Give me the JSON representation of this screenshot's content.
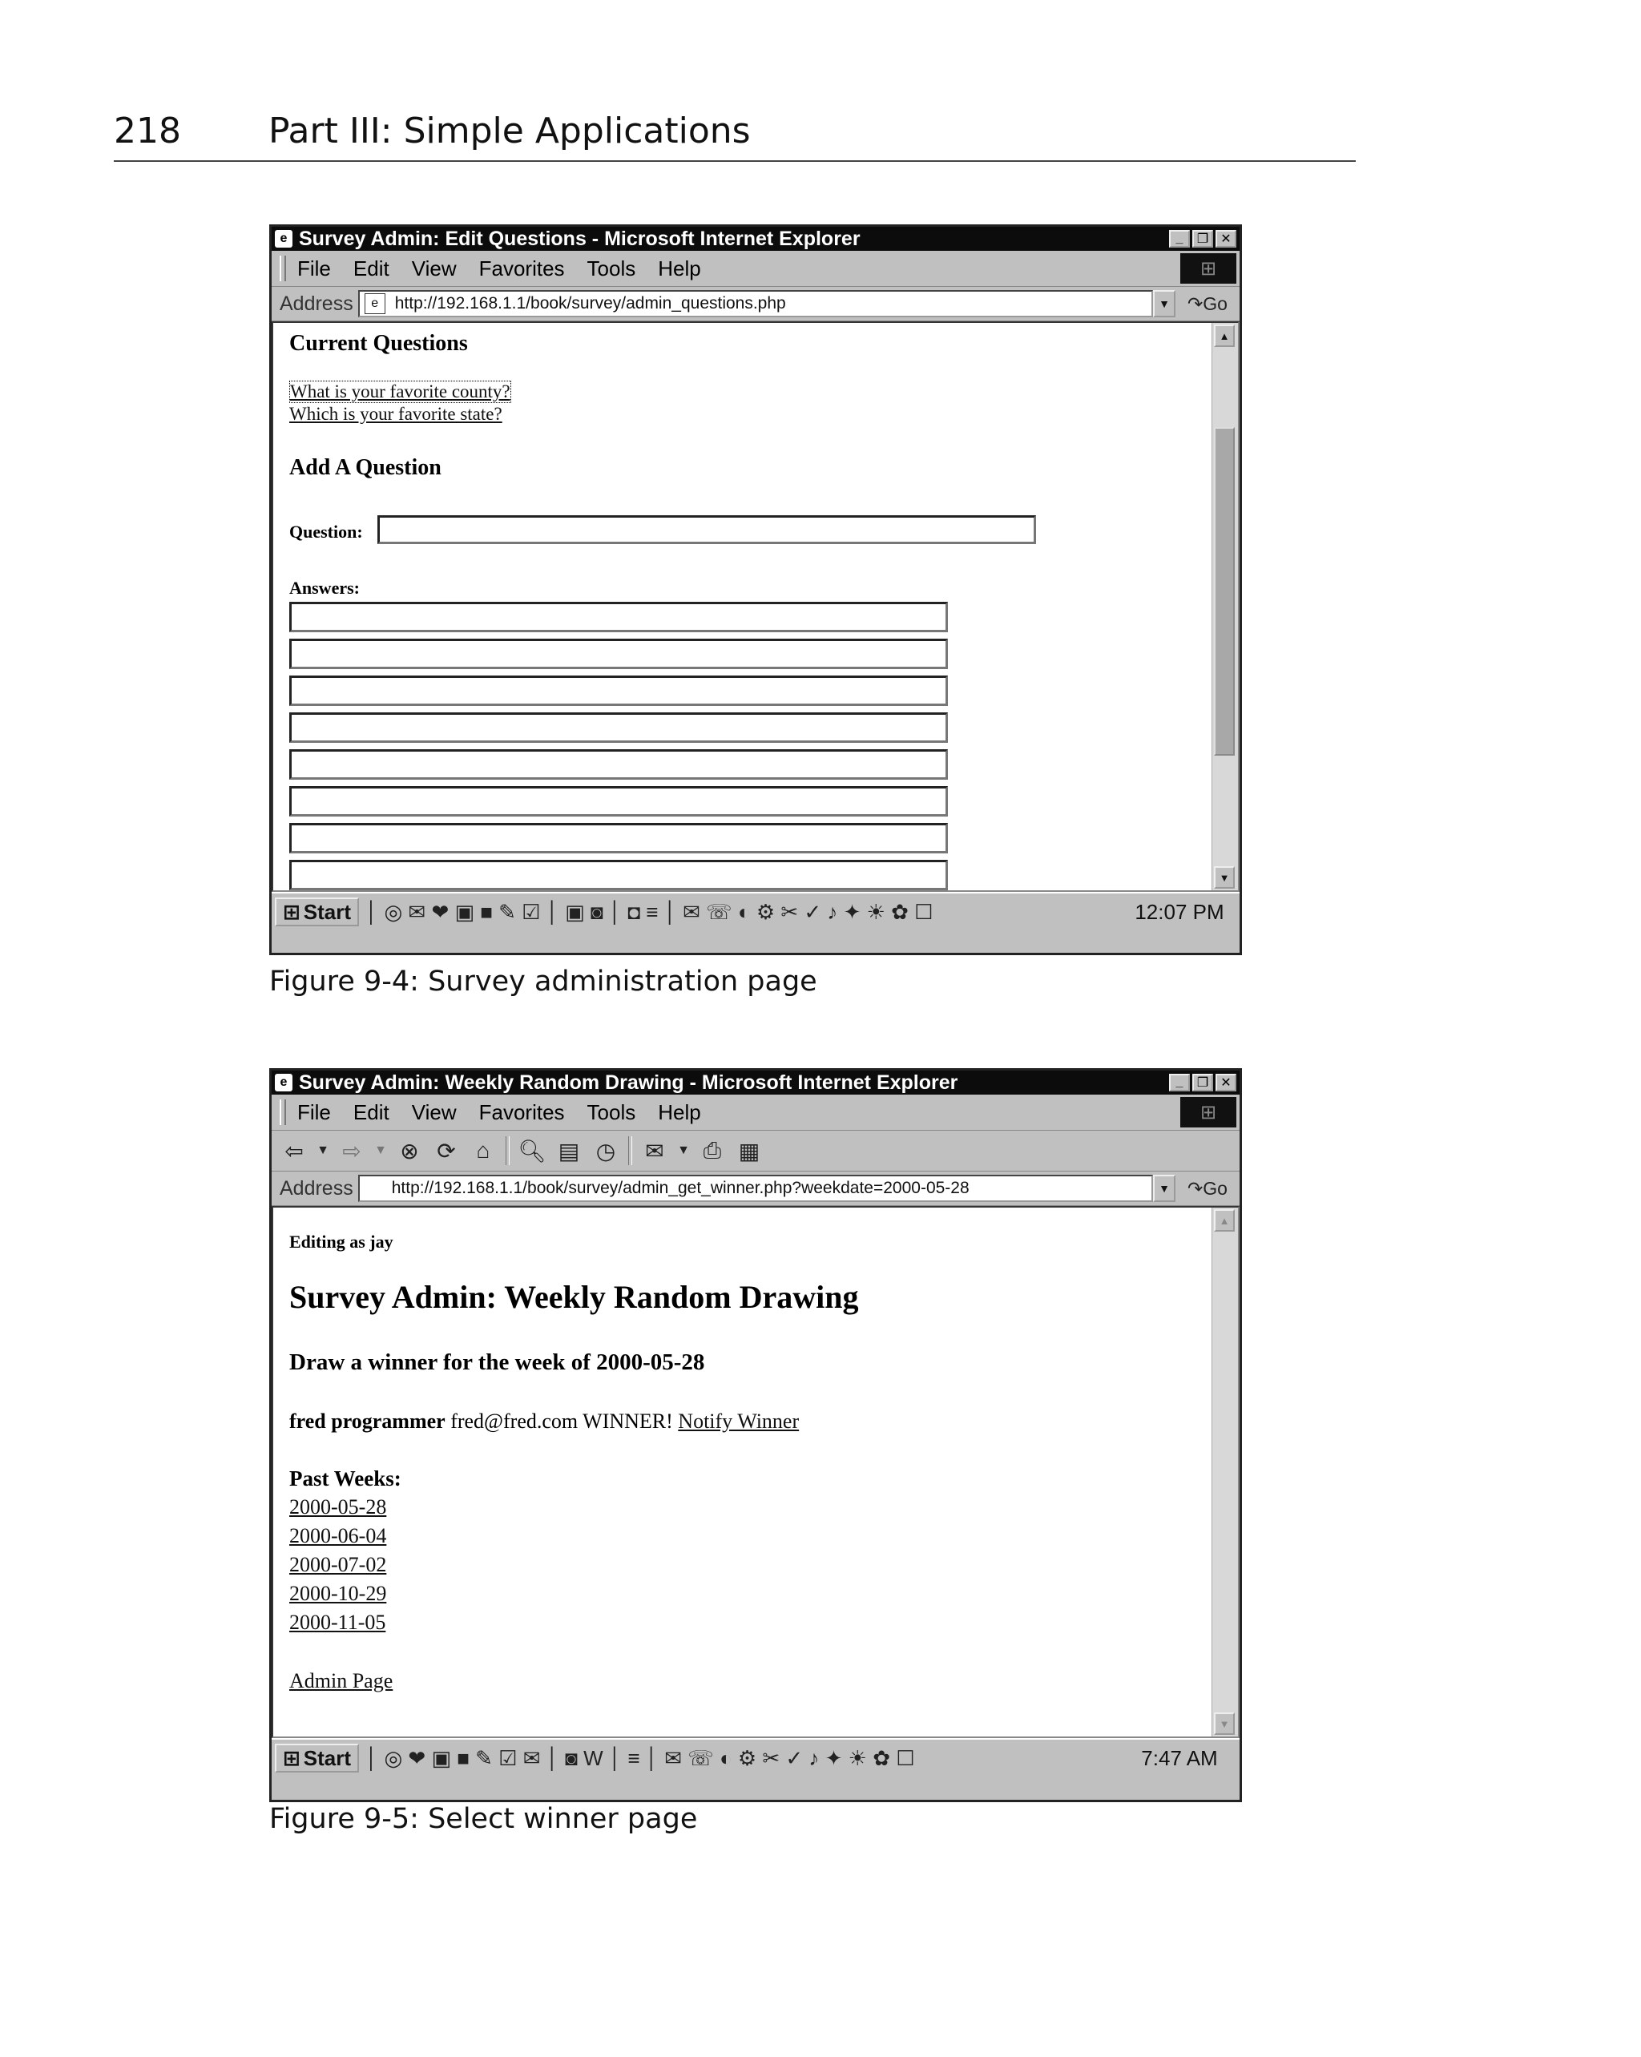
{
  "book_header": {
    "page_number": "218",
    "part_title": "Part III: Simple Applications"
  },
  "figure1": {
    "caption": "Figure 9-4: Survey administration page",
    "window": {
      "title": "Survey Admin: Edit Questions - Microsoft Internet Explorer",
      "menu": [
        "File",
        "Edit",
        "View",
        "Favorites",
        "Tools",
        "Help"
      ],
      "address_label": "Address",
      "address_url": "http://192.168.1.1/book/survey/admin_questions.php",
      "go_label": "Go"
    },
    "page": {
      "current_heading": "Current Questions",
      "questions": [
        "What is your favorite county?",
        "Which is your favorite state?"
      ],
      "add_heading": "Add A Question",
      "question_label": "Question:",
      "answers_label": "Answers:"
    },
    "taskbar": {
      "start_label": "Start",
      "clock": "12:07 PM"
    }
  },
  "figure2": {
    "caption": "Figure 9-5: Select winner page",
    "window": {
      "title": "Survey Admin: Weekly Random Drawing - Microsoft Internet Explorer",
      "menu": [
        "File",
        "Edit",
        "View",
        "Favorites",
        "Tools",
        "Help"
      ],
      "address_label": "Address",
      "address_url": "http://192.168.1.1/book/survey/admin_get_winner.php?weekdate=2000-05-28",
      "go_label": "Go"
    },
    "page": {
      "editing_as": "Editing as jay",
      "title": "Survey Admin: Weekly Random Drawing",
      "subtitle": "Draw a winner for the week of 2000-05-28",
      "winner_name": "fred programmer",
      "winner_email": "fred@fred.com",
      "winner_status": "WINNER!",
      "notify_link": "Notify Winner",
      "past_weeks_label": "Past Weeks:",
      "past_weeks": [
        "2000-05-28",
        "2000-06-04",
        "2000-07-02",
        "2000-10-29",
        "2000-11-05"
      ],
      "admin_link": "Admin Page"
    },
    "taskbar": {
      "start_label": "Start",
      "clock": "7:47 AM"
    }
  }
}
